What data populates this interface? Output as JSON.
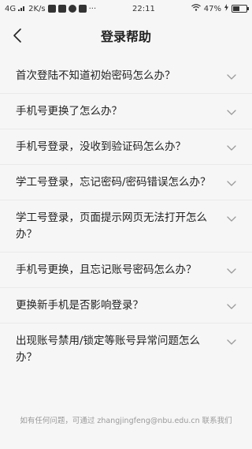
{
  "status": {
    "network": "4G",
    "speed": "2K/s",
    "more": "···",
    "time": "22:11",
    "battery": "47%"
  },
  "header": {
    "title": "登录帮助"
  },
  "faq": [
    {
      "q": "首次登陆不知道初始密码怎么办？"
    },
    {
      "q": "手机号更换了怎么办？"
    },
    {
      "q": "手机号登录，没收到验证码怎么办？"
    },
    {
      "q": "学工号登录，忘记密码/密码错误怎么办？"
    },
    {
      "q": "学工号登录，页面提示网页无法打开怎么办？"
    },
    {
      "q": "手机号更换，且忘记账号密码怎么办？"
    },
    {
      "q": "更换新手机是否影响登录？"
    },
    {
      "q": "出现账号禁用/锁定等账号异常问题怎么办？"
    }
  ],
  "footer": {
    "text": "如有任何问题，可通过 zhangjingfeng@nbu.edu.cn 联系我们"
  },
  "colors": {
    "background": "#f6f6f6",
    "text": "#222222",
    "muted": "#9a9a9a"
  },
  "icons": {
    "back": "chevron-left-icon",
    "expand": "chevron-down-icon"
  }
}
